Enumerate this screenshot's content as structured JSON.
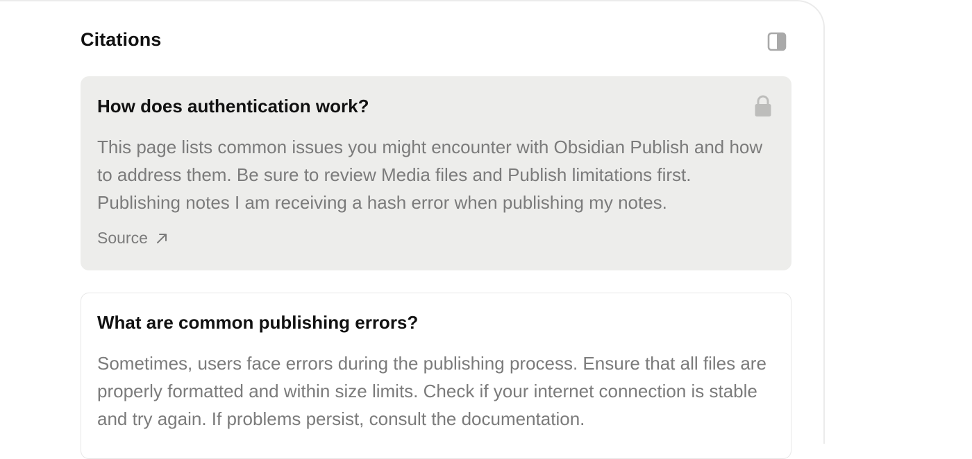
{
  "header": {
    "title": "Citations",
    "toggle_icon": "sidebar-panel-icon"
  },
  "citations": [
    {
      "title": "How does authentication work?",
      "body": "This page lists common issues you might encounter with Obsidian Publish and how to address them. Be sure to review Media files and Publish limitations first. Publishing notes I am receiving a hash error when publishing my notes.",
      "locked": true,
      "lock_icon": "lock-icon",
      "source_label": "Source",
      "source_icon": "arrow-up-right-icon"
    },
    {
      "title": "What are common publishing errors?",
      "body": "Sometimes, users face errors during the publishing process. Ensure that all files are properly formatted and within size limits. Check if your internet connection is stable and try again. If problems persist, consult the documentation."
    }
  ],
  "colors": {
    "active_card_bg": "#ededeb",
    "title_text": "#111111",
    "body_text": "#7b7b7b",
    "icon_gray": "#a9a9a9"
  }
}
